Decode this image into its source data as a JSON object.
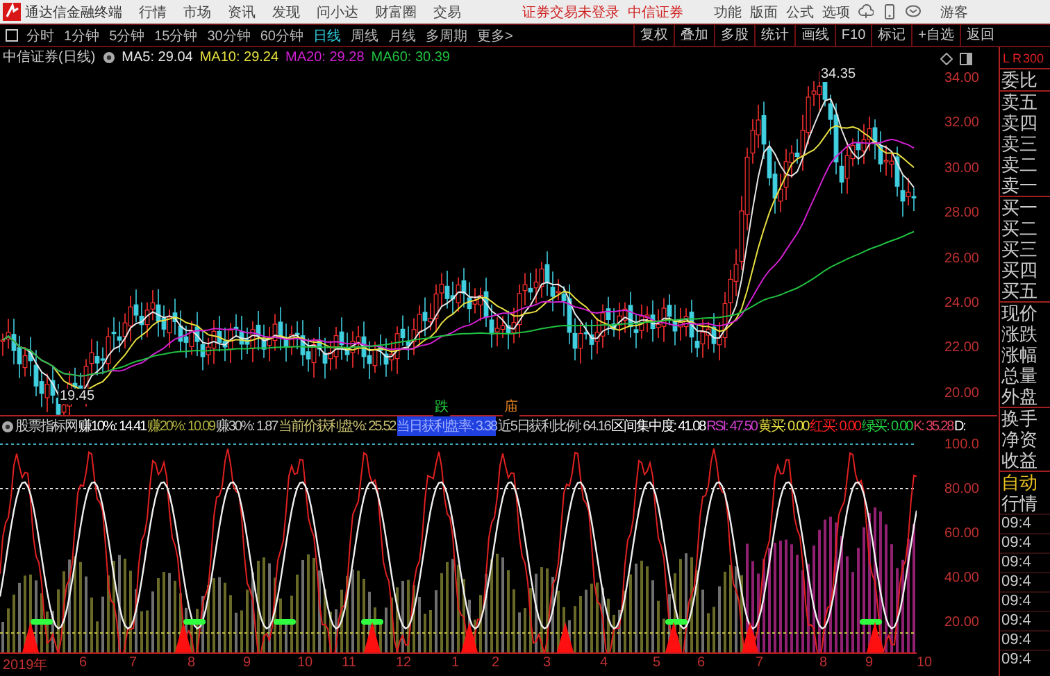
{
  "title_bar": {
    "app_name": "通达信金融终端",
    "menu": [
      "行情",
      "市场",
      "资讯",
      "发现",
      "问小达",
      "财富圈",
      "交易"
    ],
    "login_status": "证券交易未登录",
    "broker": "中信证券",
    "tools": [
      "功能",
      "版面",
      "公式",
      "选项"
    ],
    "user": "游客"
  },
  "period_tabs": [
    {
      "label": "分时",
      "selected": false
    },
    {
      "label": "1分钟",
      "selected": false
    },
    {
      "label": "5分钟",
      "selected": false
    },
    {
      "label": "15分钟",
      "selected": false
    },
    {
      "label": "30分钟",
      "selected": false
    },
    {
      "label": "60分钟",
      "selected": false
    },
    {
      "label": "日线",
      "selected": true
    },
    {
      "label": "周线",
      "selected": false
    },
    {
      "label": "月线",
      "selected": false
    },
    {
      "label": "多周期",
      "selected": false
    },
    {
      "label": "更多>",
      "selected": false
    }
  ],
  "toolbar_buttons": [
    "复权",
    "叠加",
    "多股",
    "统计",
    "画线",
    "F10",
    "标记",
    "+自选",
    "返回"
  ],
  "main_chart": {
    "title": "中信证券(日线)",
    "indicators": [
      {
        "label": "MA5: 29.04",
        "color": "#e6e6e6"
      },
      {
        "label": "MA10: 29.24",
        "color": "#e8e040"
      },
      {
        "label": "MA20: 29.28",
        "color": "#d020d0"
      },
      {
        "label": "MA60: 30.39",
        "color": "#20c040"
      }
    ],
    "price_axis": [
      "34.00",
      "32.00",
      "30.00",
      "28.00",
      "26.00",
      "24.00",
      "22.00",
      "20.00"
    ],
    "annotations": [
      {
        "kind": "high",
        "text": "34.35"
      },
      {
        "kind": "low",
        "text": "19.45"
      },
      {
        "kind": "signal",
        "text": "跌",
        "color": "#20d040"
      },
      {
        "kind": "signal",
        "text": "庙",
        "color": "#e08020"
      }
    ]
  },
  "indicator_panel": {
    "name": "股票指标网",
    "readings": [
      {
        "label": "赚10%: 14.41",
        "color": "#ffffff"
      },
      {
        "label": "赚20%: 10.09",
        "color": "#b0b040"
      },
      {
        "label": "赚30%: 1.87",
        "color": "#c8c8c8"
      },
      {
        "label": "当前价获利盘%: 25.52",
        "color": "#c8c070"
      },
      {
        "label": "当日获利盘率: 3.38",
        "color": "#2040e0"
      },
      {
        "label": "近5日获利比例: 64.16",
        "color": "#c8c8c8"
      },
      {
        "label": "区间集中度: 41.08",
        "color": "#ffffff"
      },
      {
        "label": "RSI: 47.50",
        "color": "#d040d0"
      },
      {
        "label": "黄买: 0.00",
        "color": "#e8e040"
      },
      {
        "label": "红买: 0.00",
        "color": "#ff2020"
      },
      {
        "label": "绿买: 0.00",
        "color": "#20d040"
      },
      {
        "label": "K: 35.28",
        "color": "#e04060"
      },
      {
        "label": "D:",
        "color": "#ffffff"
      }
    ],
    "axis": [
      "100.0",
      "80.00",
      "60.00",
      "40.00",
      "20.00"
    ]
  },
  "date_axis": [
    "2019年",
    "6",
    "7",
    "8",
    "9",
    "10",
    "11",
    "12",
    "1",
    "2",
    "3",
    "4",
    "5",
    "6",
    "7",
    "8",
    "9",
    "10"
  ],
  "quote_panel": {
    "corner": [
      "L",
      "R",
      "300"
    ],
    "groups": [
      [
        "委比"
      ],
      [
        "卖五",
        "卖四",
        "卖三",
        "卖二",
        "卖一"
      ],
      [
        "买一",
        "买二",
        "买三",
        "买四",
        "买五"
      ],
      [
        "现价",
        "涨跌",
        "涨幅",
        "总量",
        "外盘"
      ],
      [
        "换手",
        "净资",
        "收益"
      ]
    ],
    "mode": "自动",
    "tab": "行情",
    "ticks": [
      "09:4",
      "09:4",
      "09:4",
      "09:4",
      "09:4",
      "09:4",
      "09:4",
      "09:4"
    ]
  }
}
